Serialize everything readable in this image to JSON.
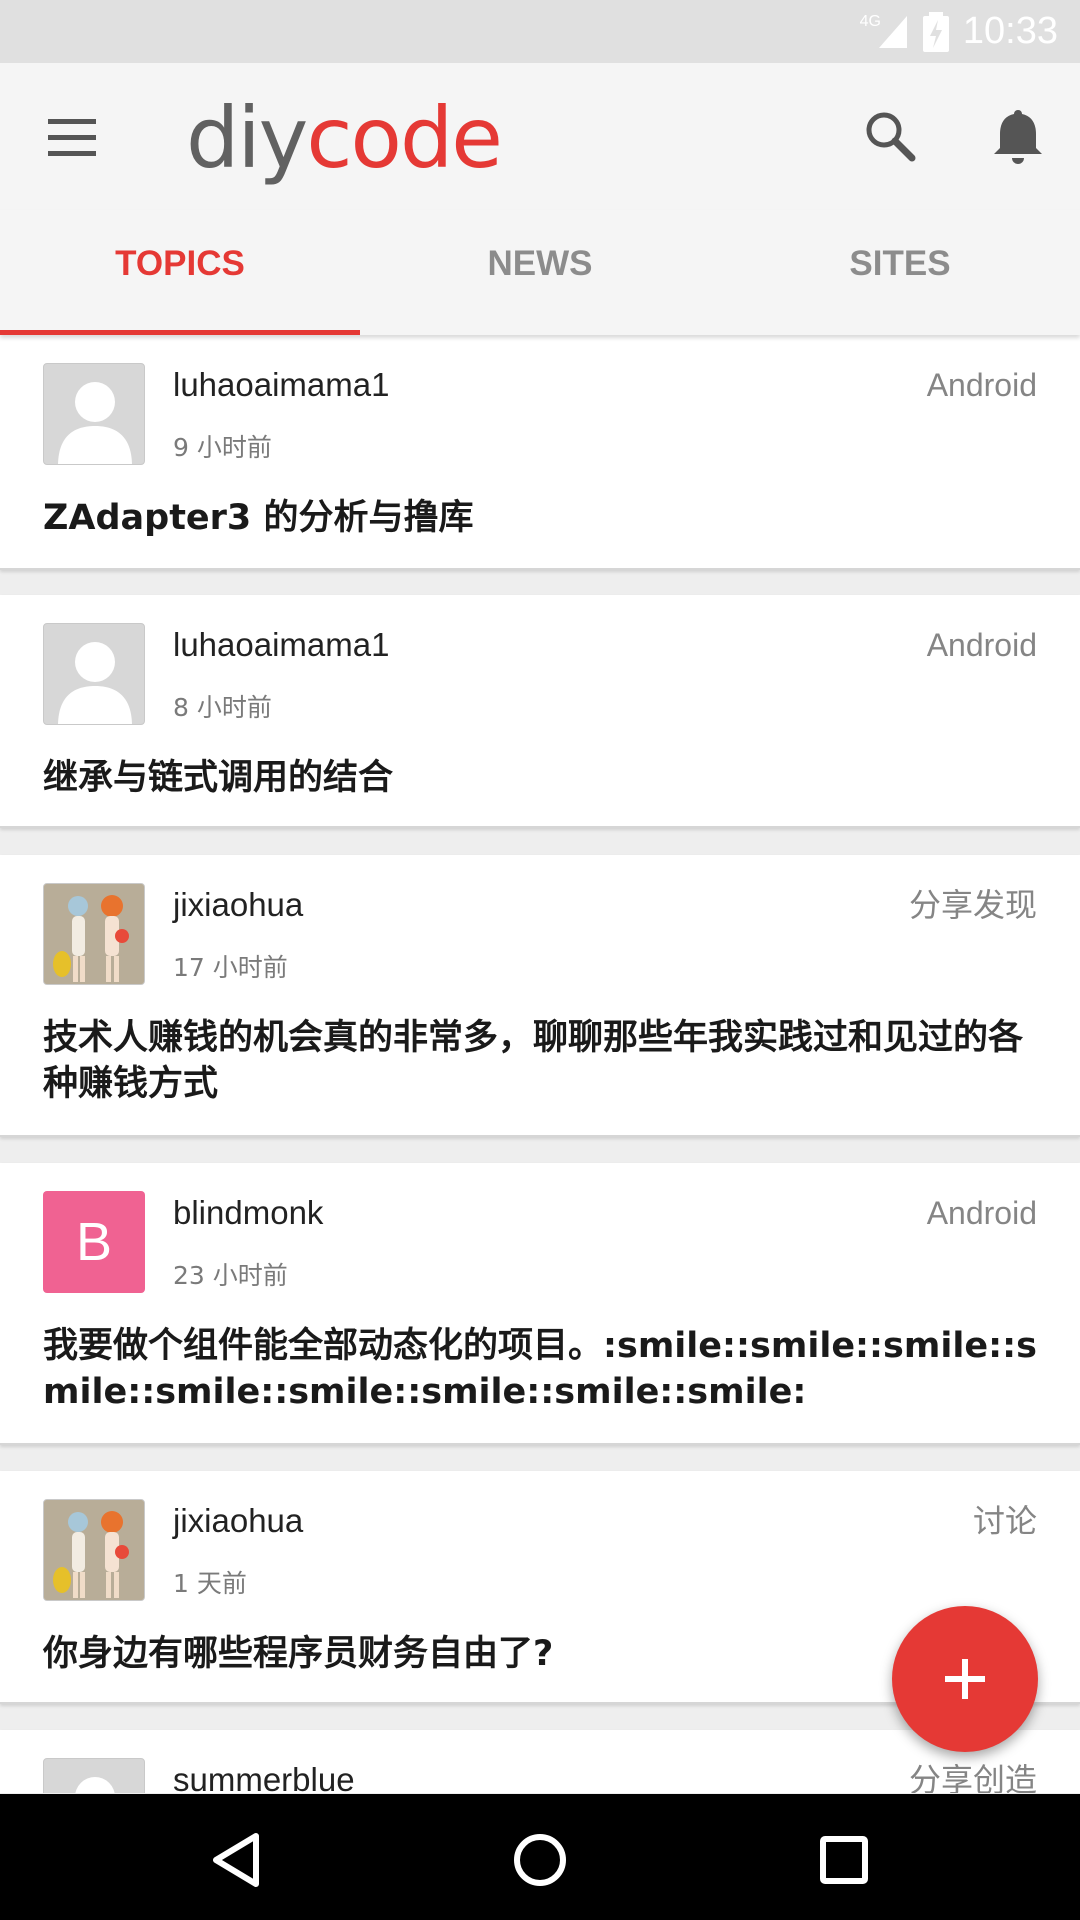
{
  "status_bar": {
    "time": "10:33",
    "network": "4G",
    "icons": [
      "signal-icon",
      "battery-charging-icon"
    ]
  },
  "toolbar": {
    "logo_part1": "diy",
    "logo_part2": "code",
    "icons": [
      "menu-icon",
      "search-icon",
      "bell-icon"
    ]
  },
  "tabs": [
    {
      "label": "TOPICS",
      "active": true
    },
    {
      "label": "NEWS",
      "active": false
    },
    {
      "label": "SITES",
      "active": false
    }
  ],
  "topics": [
    {
      "user": "luhaoaimama1",
      "node": "Android",
      "time": "9 小时前",
      "title": "ZAdapter3 的分析与撸库",
      "avatar": "default"
    },
    {
      "user": "luhaoaimama1",
      "node": "Android",
      "time": "8 小时前",
      "title": "继承与链式调用的结合",
      "avatar": "default"
    },
    {
      "user": "jixiaohua",
      "node": "分享发现",
      "time": "17 小时前",
      "title": "技术人赚钱的机会真的非常多，聊聊那些年我实践过和见过的各种赚钱方式",
      "avatar": "photo"
    },
    {
      "user": "blindmonk",
      "node": "Android",
      "time": "23 小时前",
      "title": "我要做个组件能全部动态化的项目。:smile::smile::smile::smile::smile::smile::smile::smile::smile:",
      "avatar": "letter",
      "avatar_letter": "B"
    },
    {
      "user": "jixiaohua",
      "node": "讨论",
      "time": "1 天前",
      "title": "你身边有哪些程序员财务自由了?",
      "avatar": "photo"
    },
    {
      "user": "summerblue",
      "node": "分享创造",
      "time": "",
      "title": "",
      "avatar": "default"
    }
  ],
  "fab": {
    "icon": "plus-icon"
  },
  "nav_bar": {
    "icons": [
      "back-icon",
      "home-icon",
      "recents-icon"
    ]
  },
  "colors": {
    "accent": "#e53935",
    "toolbar_bg": "#f5f5f5",
    "avatar_letter_bg": "#f06292"
  }
}
